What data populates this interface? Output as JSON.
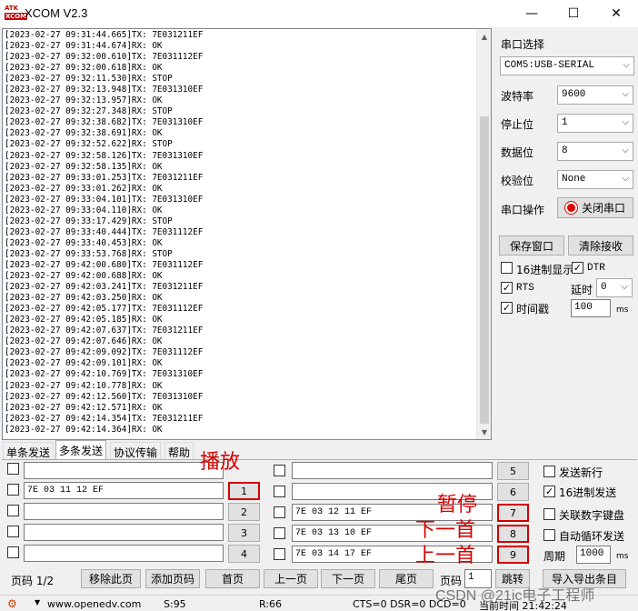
{
  "window": {
    "title": "XCOM V2.3",
    "logo_top": "ATK",
    "logo_bottom": "XCOM",
    "min": "—",
    "max": "☐",
    "close": "✕"
  },
  "log_lines": [
    "[2023-02-27 09:31:44.665]TX: 7E031211EF",
    "[2023-02-27 09:31:44.674]RX: OK",
    "[2023-02-27 09:32:00.610]TX: 7E031112EF",
    "[2023-02-27 09:32:00.618]RX: OK",
    "[2023-02-27 09:32:11.530]RX: STOP",
    "[2023-02-27 09:32:13.948]TX: 7E031310EF",
    "[2023-02-27 09:32:13.957]RX: OK",
    "[2023-02-27 09:32:27.348]RX: STOP",
    "[2023-02-27 09:32:38.682]TX: 7E031310EF",
    "[2023-02-27 09:32:38.691]RX: OK",
    "[2023-02-27 09:32:52.622]RX: STOP",
    "[2023-02-27 09:32:58.126]TX: 7E031310EF",
    "[2023-02-27 09:32:58.135]RX: OK",
    "[2023-02-27 09:33:01.253]TX: 7E031211EF",
    "[2023-02-27 09:33:01.262]RX: OK",
    "[2023-02-27 09:33:04.101]TX: 7E031310EF",
    "[2023-02-27 09:33:04.110]RX: OK",
    "[2023-02-27 09:33:17.429]RX: STOP",
    "[2023-02-27 09:33:40.444]TX: 7E031112EF",
    "[2023-02-27 09:33:40.453]RX: OK",
    "[2023-02-27 09:33:53.768]RX: STOP",
    "[2023-02-27 09:42:00.680]TX: 7E031112EF",
    "[2023-02-27 09:42:00.688]RX: OK",
    "[2023-02-27 09:42:03.241]TX: 7E031211EF",
    "[2023-02-27 09:42:03.250]RX: OK",
    "[2023-02-27 09:42:05.177]TX: 7E031112EF",
    "[2023-02-27 09:42:05.185]RX: OK",
    "[2023-02-27 09:42:07.637]TX: 7E031211EF",
    "[2023-02-27 09:42:07.646]RX: OK",
    "[2023-02-27 09:42:09.092]TX: 7E031112EF",
    "[2023-02-27 09:42:09.101]RX: OK",
    "[2023-02-27 09:42:10.769]TX: 7E031310EF",
    "[2023-02-27 09:42:10.778]RX: OK",
    "[2023-02-27 09:42:12.560]TX: 7E031310EF",
    "[2023-02-27 09:42:12.571]RX: OK",
    "[2023-02-27 09:42:14.354]TX: 7E031211EF",
    "[2023-02-27 09:42:14.364]RX: OK"
  ],
  "settings": {
    "port_label": "串口选择",
    "port_value": "COM5:USB-SERIAL",
    "baud_label": "波特率",
    "baud_value": "9600",
    "stop_label": "停止位",
    "stop_value": "1",
    "data_label": "数据位",
    "data_value": "8",
    "parity_label": "校验位",
    "parity_value": "None",
    "op_label": "串口操作",
    "op_button": "关闭串口",
    "save_window": "保存窗口",
    "clear_recv": "清除接收",
    "hex_display": "16进制显示",
    "dtr": "DTR",
    "rts": "RTS",
    "delay_label": "延时",
    "delay_value": "0",
    "timestamp": "时间戳",
    "timestamp_value": "100",
    "ms": "ms"
  },
  "tabs": [
    "单条发送",
    "多条发送",
    "协议传输",
    "帮助"
  ],
  "multi": {
    "left_rows": [
      {
        "value": "",
        "btn": ""
      },
      {
        "value": "7E 03 11 12 EF",
        "btn": "1"
      },
      {
        "value": "",
        "btn": "2"
      },
      {
        "value": "",
        "btn": "3"
      },
      {
        "value": "",
        "btn": "4"
      }
    ],
    "right_rows": [
      {
        "value": "",
        "btn": "5"
      },
      {
        "value": "",
        "btn": "6"
      },
      {
        "value": "7E 03 12 11 EF",
        "btn": "7"
      },
      {
        "value": "7E 03 13 10 EF",
        "btn": "8"
      },
      {
        "value": "7E 03 14 17 EF",
        "btn": "9"
      }
    ],
    "send_newline": "发送新行",
    "hex_send": "16进制发送",
    "link_numpad": "关联数字键盘",
    "auto_loop": "自动循环发送",
    "period_label": "周期",
    "period_value": "1000",
    "ms": "ms",
    "page_label": "页码 1/2",
    "remove_page": "移除此页",
    "add_page": "添加页码",
    "first_page": "首页",
    "prev_page": "上一页",
    "next_page": "下一页",
    "last_page": "尾页",
    "page_input_label": "页码",
    "page_input_value": "1",
    "jump": "跳转",
    "import_export": "导入导出条目"
  },
  "annotations": {
    "play": "播放",
    "pause": "暂停",
    "next": "下一首",
    "prev": "上一首"
  },
  "statusbar": {
    "url": "www.openedv.com",
    "s": "S:95",
    "r": "R:66",
    "signals": "CTS=0 DSR=0 DCD=0",
    "time": "当前时间 21:42:24"
  },
  "watermark": "CSDN @21ic电子工程师",
  "colors": {
    "accent_red": "#d40000",
    "log_bg": "#ffffff",
    "panel_bg": "#f0f0f0"
  }
}
